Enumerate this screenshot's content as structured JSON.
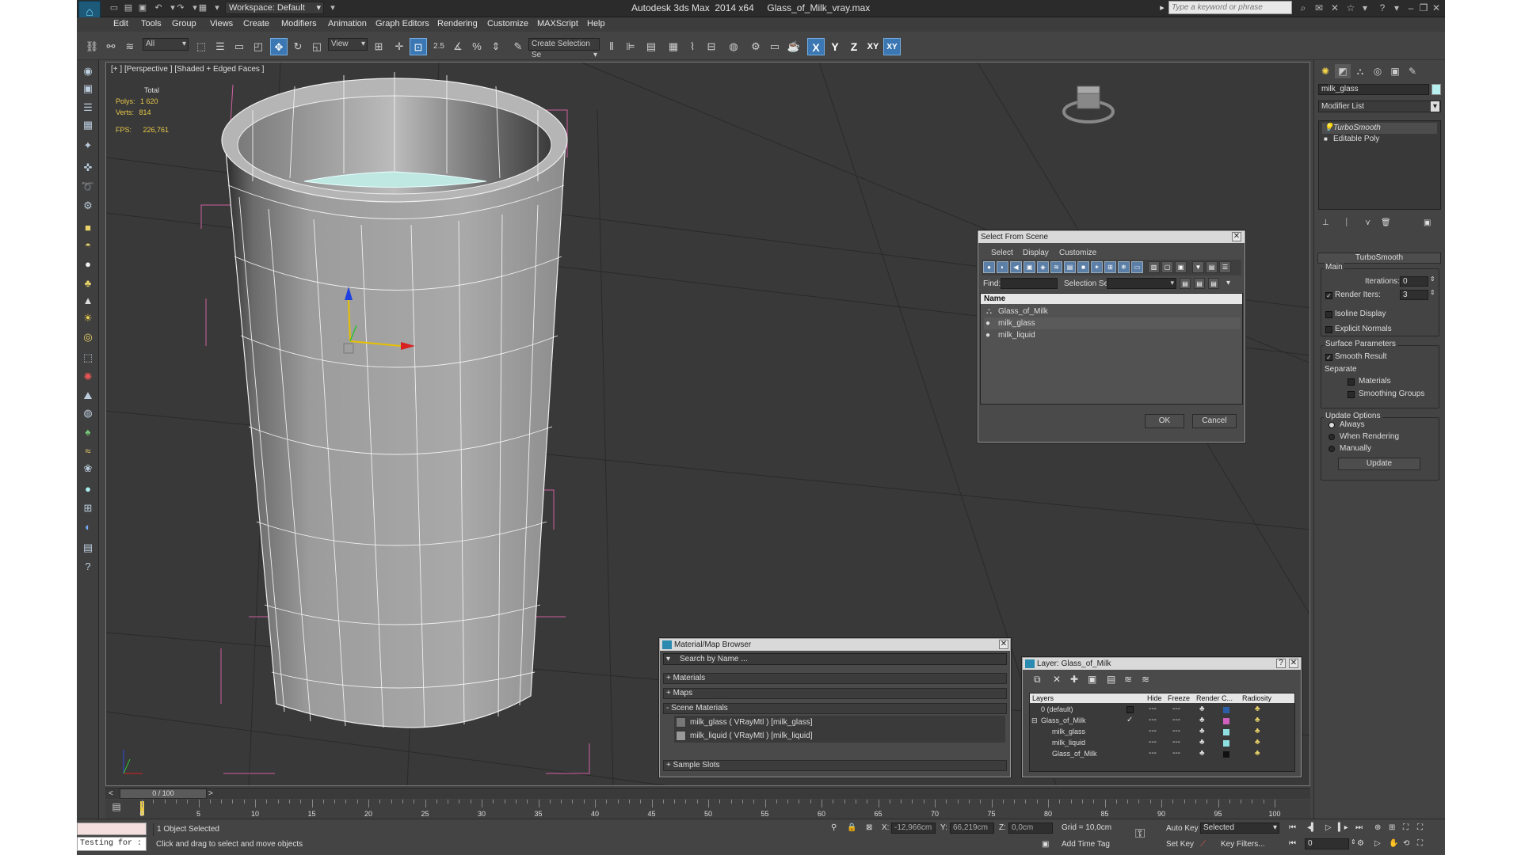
{
  "titlebar": {
    "workspace": "Workspace: Default",
    "app_title": "Autodesk 3ds Max  2014 x64     Glass_of_Milk_vray.max",
    "search_placeholder": "Type a keyword or phrase"
  },
  "menubar": {
    "items": [
      "Edit",
      "Tools",
      "Group",
      "Views",
      "Create",
      "Modifiers",
      "Animation",
      "Graph Editors",
      "Rendering",
      "Customize",
      "MAXScript",
      "Help"
    ]
  },
  "toolbar": {
    "selection_filter": "All",
    "reference_coord": "View",
    "named_selection": "Create Selection Se",
    "axis_x": "X",
    "axis_y": "Y",
    "axis_z": "Z",
    "axis_xy": "XY",
    "snap_label": "2.5"
  },
  "viewport": {
    "label": "[+ ] [Perspective ] [Shaded + Edged Faces ]",
    "stats": {
      "total_label": "Total",
      "polys_label": "Polys:",
      "polys_value": "1 620",
      "verts_label": "Verts:",
      "verts_value": "814",
      "fps_label": "FPS:",
      "fps_value": "226,761"
    }
  },
  "command_panel": {
    "object_name": "milk_glass",
    "object_color": "#b8f0f0",
    "modifier_list": "Modifier List",
    "stack": [
      "TurboSmooth",
      "Editable Poly"
    ],
    "turbosmooth": {
      "title": "TurboSmooth",
      "main": "Main",
      "iterations_label": "Iterations:",
      "iterations_value": "0",
      "render_iters_label": "Render Iters:",
      "render_iters_value": "3",
      "isoline_display": "Isoline Display",
      "explicit_normals": "Explicit Normals",
      "surface_parameters": "Surface Parameters",
      "smooth_result": "Smooth Result",
      "separate": "Separate",
      "materials": "Materials",
      "smoothing_groups": "Smoothing Groups",
      "update_options": "Update Options",
      "always": "Always",
      "when_rendering": "When Rendering",
      "manually": "Manually",
      "update_button": "Update"
    }
  },
  "select_from_scene": {
    "title": "Select From Scene",
    "menus": [
      "Select",
      "Display",
      "Customize"
    ],
    "find_label": "Find:",
    "selection_set_label": "Selection Set:",
    "column_name": "Name",
    "rows": [
      "Glass_of_Milk",
      "milk_glass",
      "milk_liquid"
    ],
    "ok": "OK",
    "cancel": "Cancel"
  },
  "material_browser": {
    "title": "Material/Map Browser",
    "search_placeholder": "Search by Name ...",
    "materials": "+ Materials",
    "maps": "+ Maps",
    "scene_materials": "- Scene Materials",
    "scene_items": [
      "milk_glass  ( VRayMtl ) [milk_glass]",
      "milk_liquid  ( VRayMtl ) [milk_liquid]"
    ],
    "sample_slots": "+ Sample Slots"
  },
  "layer_dialog": {
    "title": "Layer: Glass_of_Milk",
    "help": "?",
    "columns": [
      "Layers",
      "Hide",
      "Freeze",
      "Render",
      "C...",
      "Radiosity"
    ],
    "rows": [
      {
        "name": "0 (default)",
        "color": "#2b5fa8"
      },
      {
        "name": "Glass_of_Milk",
        "color": "#d060c0"
      },
      {
        "name": "milk_glass",
        "color": "#8fe0e0"
      },
      {
        "name": "milk_liquid",
        "color": "#8fe0e0"
      },
      {
        "name": "Glass_of_Milk",
        "color": "#111111"
      }
    ]
  },
  "timeline": {
    "frame_display": "0 / 100",
    "ticks": [
      "0",
      "5",
      "10",
      "15",
      "20",
      "25",
      "30",
      "35",
      "40",
      "45",
      "50",
      "55",
      "60",
      "65",
      "70",
      "75",
      "80",
      "85",
      "90",
      "95",
      "100"
    ]
  },
  "statusbar": {
    "maxscript_text": "Testing for :",
    "selection_info": "1 Object Selected",
    "prompt": "Click and drag to select and move objects",
    "x_label": "X:",
    "x_value": "-12,966cm",
    "y_label": "Y:",
    "y_value": "66,219cm",
    "z_label": "Z:",
    "z_value": "0,0cm",
    "grid": "Grid = 10,0cm",
    "add_time_tag": "Add Time Tag",
    "auto_key": "Auto Key",
    "selected": "Selected",
    "set_key": "Set Key",
    "key_filters": "Key Filters...",
    "frame_value": "0"
  }
}
